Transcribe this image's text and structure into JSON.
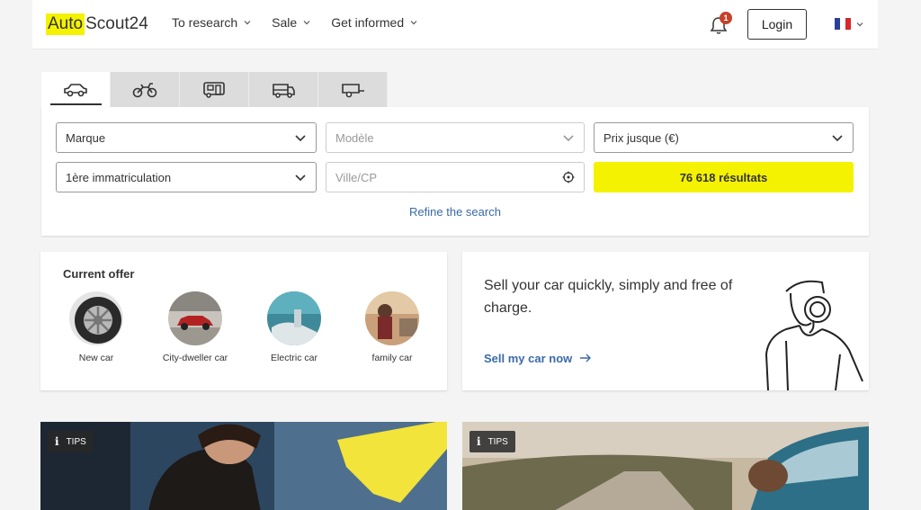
{
  "header": {
    "logo_part1": "Auto",
    "logo_part2": "Scout24",
    "nav": [
      {
        "label": "To research"
      },
      {
        "label": "Sale"
      },
      {
        "label": "Get informed"
      }
    ],
    "notification_count": "1",
    "login_label": "Login",
    "language_flag": "FR"
  },
  "vehicle_tabs": [
    {
      "icon": "car-icon",
      "active": true
    },
    {
      "icon": "motorcycle-icon",
      "active": false
    },
    {
      "icon": "camper-van-icon",
      "active": false
    },
    {
      "icon": "transporter-icon",
      "active": false
    },
    {
      "icon": "trailer-icon",
      "active": false
    }
  ],
  "search": {
    "brand": "Marque",
    "model_placeholder": "Modèle",
    "price": "Prix jusque (€)",
    "registration": "1ère immatriculation",
    "city_placeholder": "Ville/CP",
    "results_label": "76 618 résultats",
    "refine_label": "Refine the search"
  },
  "offer": {
    "title": "Current offer",
    "categories": [
      {
        "label": "New car"
      },
      {
        "label": "City-dweller car"
      },
      {
        "label": "Electric car"
      },
      {
        "label": "family car"
      }
    ]
  },
  "sell": {
    "text": "Sell your car quickly, simply and free of charge.",
    "link": "Sell my car now"
  },
  "tips": [
    {
      "badge": "TIPS"
    },
    {
      "badge": "TIPS"
    }
  ],
  "colors": {
    "accent_yellow": "#f5f200",
    "link_blue": "#3a6aa8",
    "badge_red": "#c6412a"
  }
}
